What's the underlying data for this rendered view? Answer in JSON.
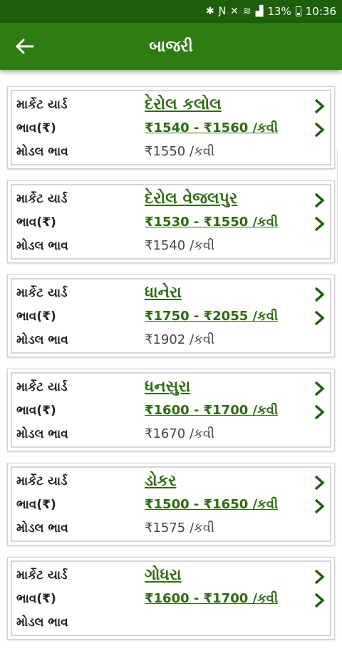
{
  "status_bar": {
    "battery": "13%",
    "time": "10:36",
    "icons": [
      "bluetooth-icon",
      "nfc-icon",
      "mute-icon",
      "wifi-icon",
      "signal-icon",
      "battery-icon"
    ]
  },
  "app_bar": {
    "title": "બાજરી",
    "back_icon": "arrow-left-icon"
  },
  "labels": {
    "market_yard": "માર્કેટ યાર્ડ",
    "price": "ભાવ(₹)",
    "model_price": "મોડલ ભાવ"
  },
  "colors": {
    "status_bar": "#1e5f0b",
    "app_bar": "#2e7d12",
    "accent_text": "#2e6b12"
  },
  "markets": [
    {
      "name": "દેરોલ કલોલ",
      "price": "₹1540 - ₹1560 /કવી",
      "model": "₹1550 /કવી"
    },
    {
      "name": "દેરોલ વેજલપુર",
      "price": "₹1530 - ₹1550 /કવી",
      "model": "₹1540 /કવી"
    },
    {
      "name": "ધાનેરા",
      "price": "₹1750 - ₹2055 /કવી",
      "model": "₹1902 /કવી"
    },
    {
      "name": "ધનસુરા",
      "price": "₹1600 - ₹1700 /કવી",
      "model": "₹1670 /કવી"
    },
    {
      "name": "ડોકર",
      "price": "₹1500 - ₹1650 /કવી",
      "model": "₹1575 /કવી"
    },
    {
      "name": "ગોધરા",
      "price": "₹1600 - ₹1700 /કવી",
      "model": ""
    }
  ]
}
